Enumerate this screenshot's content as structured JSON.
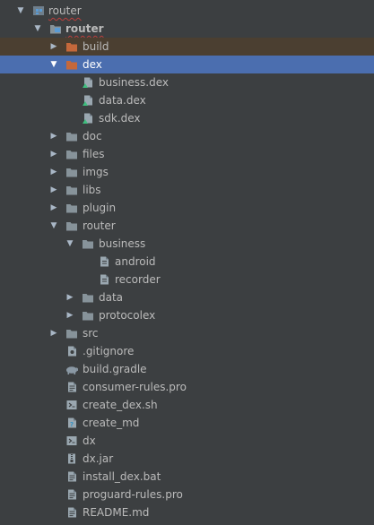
{
  "colors": {
    "background": "#3c3f41",
    "text": "#bbbbbb",
    "selected": "#4b6eaf",
    "highlighted": "#4b3f31",
    "folder": "#87939a",
    "excluded_folder": "#c4683b",
    "dex_badge": "#3fbf7f",
    "error_underline": "#bc3f3c"
  },
  "tree": {
    "root": {
      "label": "router",
      "icon": "project-icon"
    },
    "module": {
      "label": "router",
      "icon": "module-folder-icon"
    },
    "nodes": [
      {
        "label": "build",
        "icon": "folder-excluded-icon",
        "expanded": false
      },
      {
        "label": "dex",
        "icon": "folder-excluded-icon",
        "expanded": true,
        "selected": true
      },
      {
        "label": "business.dex",
        "icon": "dex-file-icon"
      },
      {
        "label": "data.dex",
        "icon": "dex-file-icon"
      },
      {
        "label": "sdk.dex",
        "icon": "dex-file-icon"
      },
      {
        "label": "doc",
        "icon": "folder-icon",
        "expanded": false
      },
      {
        "label": "files",
        "icon": "folder-icon",
        "expanded": false
      },
      {
        "label": "imgs",
        "icon": "folder-icon",
        "expanded": false
      },
      {
        "label": "libs",
        "icon": "folder-icon",
        "expanded": false
      },
      {
        "label": "plugin",
        "icon": "folder-icon",
        "expanded": false
      },
      {
        "label": "router",
        "icon": "folder-icon",
        "expanded": true
      },
      {
        "label": "business",
        "icon": "folder-icon",
        "expanded": true
      },
      {
        "label": "android",
        "icon": "file-icon"
      },
      {
        "label": "recorder",
        "icon": "file-icon"
      },
      {
        "label": "data",
        "icon": "folder-icon",
        "expanded": false
      },
      {
        "label": "protocolex",
        "icon": "folder-icon",
        "expanded": false
      },
      {
        "label": "src",
        "icon": "folder-icon",
        "expanded": false
      },
      {
        "label": ".gitignore",
        "icon": "gitignore-file-icon"
      },
      {
        "label": "build.gradle",
        "icon": "gradle-elephant-icon"
      },
      {
        "label": "consumer-rules.pro",
        "icon": "text-file-icon"
      },
      {
        "label": "create_dex.sh",
        "icon": "shell-script-icon"
      },
      {
        "label": "create_md",
        "icon": "unknown-file-icon"
      },
      {
        "label": "dx",
        "icon": "shell-script-icon"
      },
      {
        "label": "dx.jar",
        "icon": "jar-file-icon"
      },
      {
        "label": "install_dex.bat",
        "icon": "text-file-icon"
      },
      {
        "label": "proguard-rules.pro",
        "icon": "text-file-icon"
      },
      {
        "label": "README.md",
        "icon": "text-file-icon"
      }
    ]
  }
}
